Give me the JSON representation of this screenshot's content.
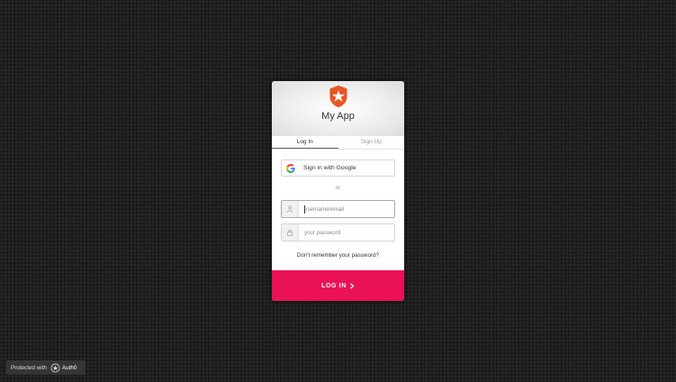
{
  "app": {
    "title": "My App",
    "logo_icon": "auth0-shield-star-icon",
    "logo_color": "#eb5424"
  },
  "tabs": [
    {
      "label": "Log In",
      "active": true
    },
    {
      "label": "Sign Up",
      "active": false
    }
  ],
  "social": {
    "google_label": "Sign in with Google",
    "icon": "google-icon"
  },
  "separator": "or",
  "fields": {
    "username": {
      "placeholder": "username/email",
      "value": "",
      "icon": "user-icon"
    },
    "password": {
      "placeholder": "your password",
      "value": "",
      "icon": "lock-icon"
    }
  },
  "forgot_link": "Don't remember your password?",
  "submit": {
    "label": "LOG IN",
    "color": "#ea1156"
  },
  "footer_badge": {
    "prefix": "Protected with",
    "brand": "Auth0"
  }
}
